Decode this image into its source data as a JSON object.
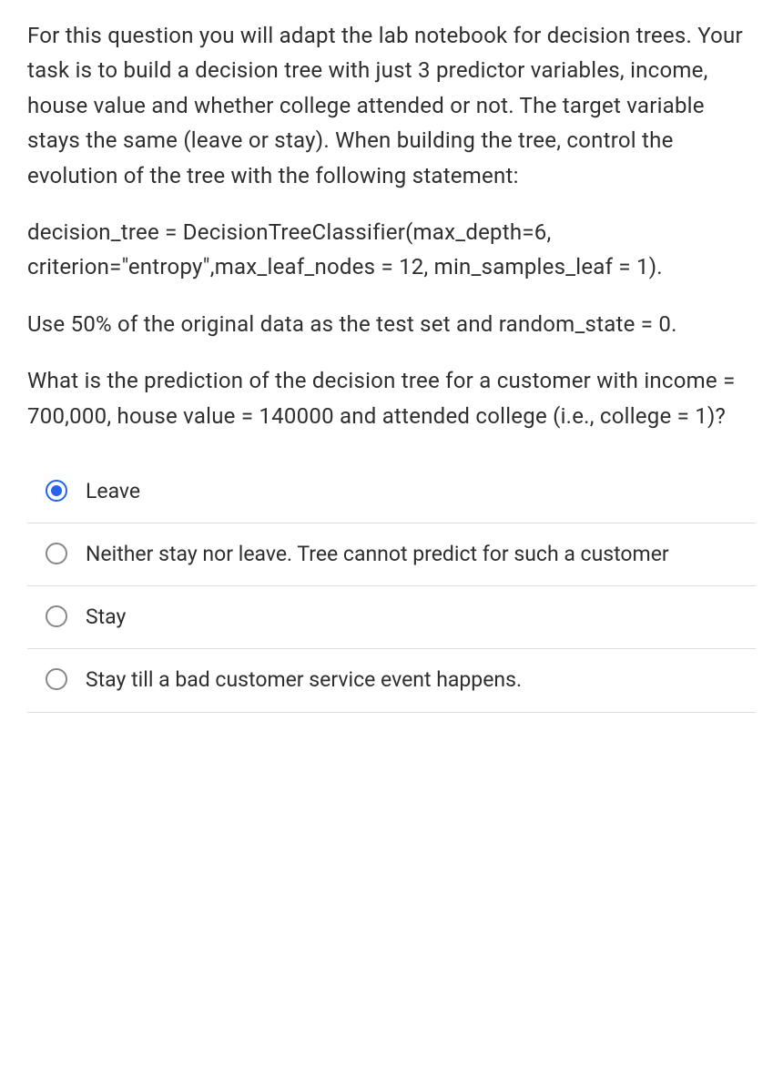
{
  "question": {
    "p1": "For this question you will adapt the lab notebook for decision trees.  Your task is to build a decision tree with just 3 predictor variables, income, house value and whether college attended or not.  The target variable stays the same (leave or stay).  When building the tree, control the evolution of the tree with the following statement:",
    "p2": "decision_tree = DecisionTreeClassifier(max_depth=6, criterion=\"entropy\",max_leaf_nodes = 12, min_samples_leaf = 1).",
    "p3": "Use 50% of the original data as the test set and random_state = 0.",
    "p4": "What is the prediction of the decision tree for a customer with income = 700,000, house value = 140000 and attended college (i.e., college = 1)?"
  },
  "options": [
    {
      "label": "Leave",
      "selected": true
    },
    {
      "label": "Neither stay nor leave. Tree cannot predict for such a customer",
      "selected": false
    },
    {
      "label": "Stay",
      "selected": false
    },
    {
      "label": "Stay till a bad customer service event happens.",
      "selected": false
    }
  ]
}
